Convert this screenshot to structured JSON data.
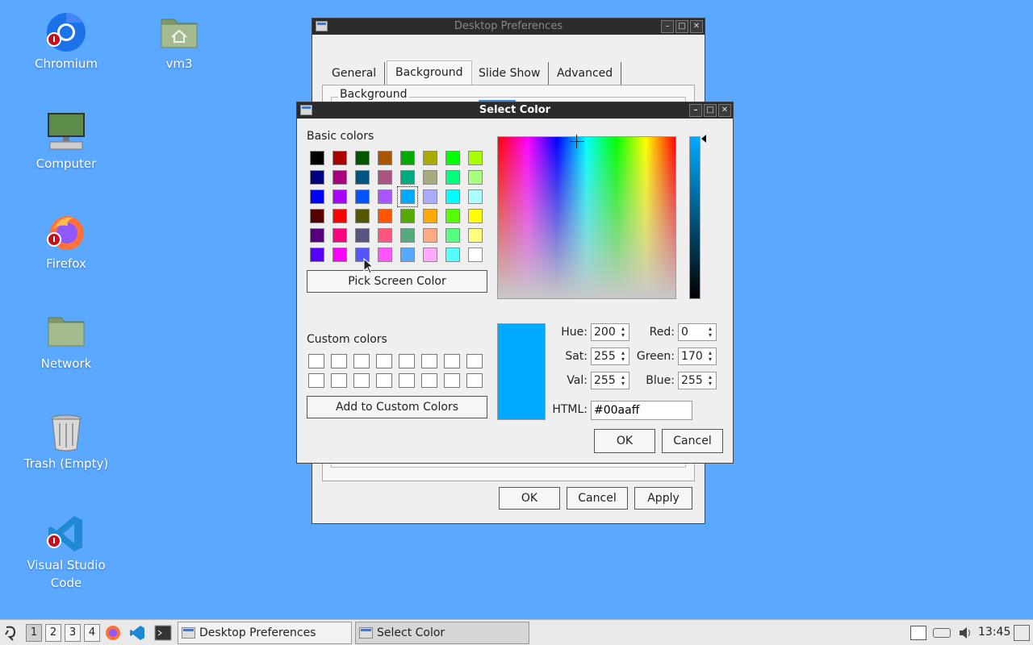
{
  "desktop": {
    "icons": [
      {
        "label": "Chromium",
        "icon": "chromium-icon"
      },
      {
        "label": "vm3",
        "icon": "home-folder-icon"
      },
      {
        "label": "Computer",
        "icon": "computer-icon"
      },
      {
        "label": "Firefox",
        "icon": "firefox-icon"
      },
      {
        "label": "Network",
        "icon": "network-folder-icon"
      },
      {
        "label": "Trash (Empty)",
        "icon": "trash-icon"
      },
      {
        "label": "Visual Studio Code",
        "icon": "vscode-icon"
      }
    ]
  },
  "prefs": {
    "title": "Desktop Preferences",
    "tabs": [
      "General",
      "Background",
      "Slide Show",
      "Advanced"
    ],
    "active_tab": "Background",
    "group_label": "Background",
    "buttons": {
      "ok": "OK",
      "cancel": "Cancel",
      "apply": "Apply"
    }
  },
  "color_dialog": {
    "title": "Select Color",
    "basic_label": "Basic colors",
    "basic_colors": [
      "#000000",
      "#aa0000",
      "#005500",
      "#aa5500",
      "#00aa00",
      "#aaaa00",
      "#00ff00",
      "#aaff00",
      "#00007f",
      "#aa007f",
      "#00557f",
      "#aa557f",
      "#00aa7f",
      "#aaaa7f",
      "#00ff7f",
      "#aaff7f",
      "#0000ff",
      "#aa00ff",
      "#0055ff",
      "#aa55ff",
      "#00aaff",
      "#aaaaff",
      "#00ffff",
      "#aaffff",
      "#550000",
      "#ff0000",
      "#555500",
      "#ff5500",
      "#55aa00",
      "#ffaa00",
      "#55ff00",
      "#ffff00",
      "#55007f",
      "#ff007f",
      "#55557f",
      "#ff557f",
      "#55aa7f",
      "#ffaa7f",
      "#55ff7f",
      "#ffff7f",
      "#5500ff",
      "#ff00ff",
      "#5555ff",
      "#ff55ff",
      "#55aaff",
      "#ffaaff",
      "#55ffff",
      "#ffffff"
    ],
    "selected_index": 20,
    "pick_screen_label": "Pick Screen Color",
    "custom_label": "Custom colors",
    "add_custom_label": "Add to Custom Colors",
    "hue_label": "Hue:",
    "hue": "200",
    "sat_label": "Sat:",
    "sat": "255",
    "val_label": "Val:",
    "val": "255",
    "red_label": "Red:",
    "red": "0",
    "green_label": "Green:",
    "green": "170",
    "blue_label": "Blue:",
    "blue": "255",
    "html_label": "HTML:",
    "html": "#00aaff",
    "current_color": "#00aaff",
    "ok": "OK",
    "cancel": "Cancel"
  },
  "taskbar": {
    "workspaces": [
      "1",
      "2",
      "3",
      "4"
    ],
    "active_workspace": "1",
    "tasks": [
      {
        "label": "Desktop Preferences"
      },
      {
        "label": "Select Color"
      }
    ],
    "clock": "13:45"
  }
}
